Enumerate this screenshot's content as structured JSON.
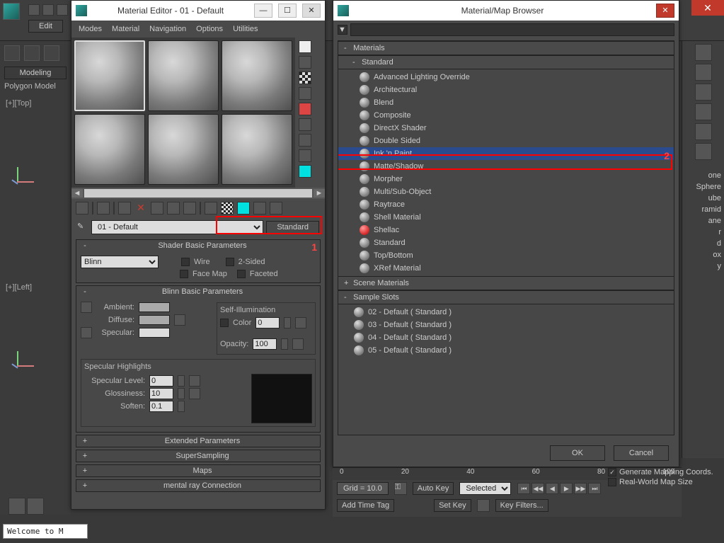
{
  "app": {
    "edit_label": "Edit",
    "close_glyph": "✕"
  },
  "left": {
    "modeling": "Modeling",
    "polygon": "Polygon Model",
    "vp_top": "[+][Top]",
    "vp_left": "[+][Left]"
  },
  "right_peek": [
    "one",
    "Sphere",
    "ube",
    "ramid",
    "ane",
    "r",
    "d",
    "ox",
    "y"
  ],
  "mat_editor": {
    "title": "Material Editor - 01 - Default",
    "min": "—",
    "max": "☐",
    "close": "✕",
    "menu": [
      "Modes",
      "Material",
      "Navigation",
      "Options",
      "Utilities"
    ],
    "scroll_left": "◄",
    "scroll_right": "►",
    "pick_glyph": "✎",
    "name": "01 - Default",
    "type_btn": "Standard",
    "annot1": "1",
    "rollouts": {
      "shader_basic": {
        "title": "Shader Basic Parameters",
        "shader": "Blinn",
        "wire": "Wire",
        "twosided": "2-Sided",
        "facemap": "Face Map",
        "faceted": "Faceted"
      },
      "blinn": {
        "title": "Blinn Basic Parameters",
        "ambient": "Ambient:",
        "diffuse": "Diffuse:",
        "specular": "Specular:",
        "selfillum_grp": "Self-Illumination",
        "color": "Color",
        "color_val": "0",
        "opacity": "Opacity:",
        "opacity_val": "100",
        "spec_grp": "Specular Highlights",
        "spec_level": "Specular Level:",
        "spec_level_val": "0",
        "gloss": "Glossiness:",
        "gloss_val": "10",
        "soften": "Soften:",
        "soften_val": "0.1"
      },
      "collapsed": [
        "Extended Parameters",
        "SuperSampling",
        "Maps",
        "mental ray Connection"
      ]
    }
  },
  "browser": {
    "title": "Material/Map Browser",
    "close": "✕",
    "sections": {
      "materials": "Materials",
      "standard": "Standard",
      "scene": "Scene Materials",
      "slots": "Sample Slots"
    },
    "std_materials": [
      "Advanced Lighting Override",
      "Architectural",
      "Blend",
      "Composite",
      "DirectX Shader",
      "Double Sided",
      "Ink 'n Paint",
      "Matte/Shadow",
      "Morpher",
      "Multi/Sub-Object",
      "Raytrace",
      "Shell Material",
      "Shellac",
      "Standard",
      "Top/Bottom",
      "XRef Material"
    ],
    "selected_index": 6,
    "shellac_red_index": 12,
    "annot2": "2",
    "sample_slots": [
      "02 - Default  ( Standard )",
      "03 - Default  ( Standard )",
      "04 - Default  ( Standard )",
      "05 - Default  ( Standard )"
    ],
    "ok": "OK",
    "cancel": "Cancel"
  },
  "timeline": {
    "ticks": [
      "0",
      "20",
      "40",
      "60",
      "80",
      "100"
    ],
    "grid": "Grid = 10.0",
    "autokey": "Auto Key",
    "selected": "Selected",
    "addtag": "Add Time Tag",
    "setkey": "Set Key",
    "keyfilters": "Key Filters...",
    "play": [
      "⏮",
      "◀◀",
      "◀",
      "▶",
      "▶▶",
      "⏭"
    ]
  },
  "bottom_opts": {
    "gen": "Generate Mapping Coords.",
    "real": "Real-World Map Size"
  },
  "status": "Welcome to M"
}
